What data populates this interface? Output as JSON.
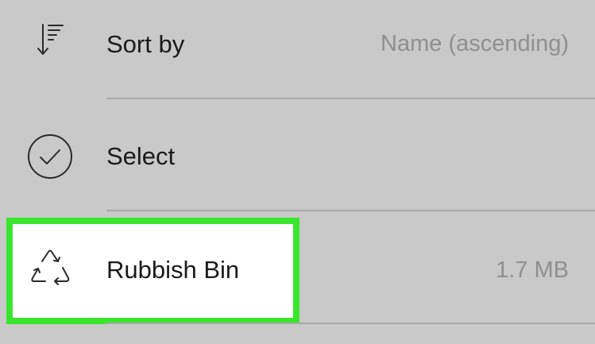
{
  "menu": {
    "items": [
      {
        "id": "sort",
        "icon": "sort-descending-icon",
        "label": "Sort by",
        "value": "Name (ascending)"
      },
      {
        "id": "select",
        "icon": "checkmark-circle-icon",
        "label": "Select",
        "value": ""
      },
      {
        "id": "rubbish-bin",
        "icon": "recycle-icon",
        "label": "Rubbish Bin",
        "value": "1.7 MB",
        "highlighted": true
      }
    ]
  },
  "colors": {
    "background": "#c9c9c9",
    "highlight_border": "#39e62d",
    "highlight_fill": "#ffffff",
    "label_text": "#1a1a1a",
    "value_text": "#8f8f8f",
    "divider": "#a9a9a9"
  }
}
